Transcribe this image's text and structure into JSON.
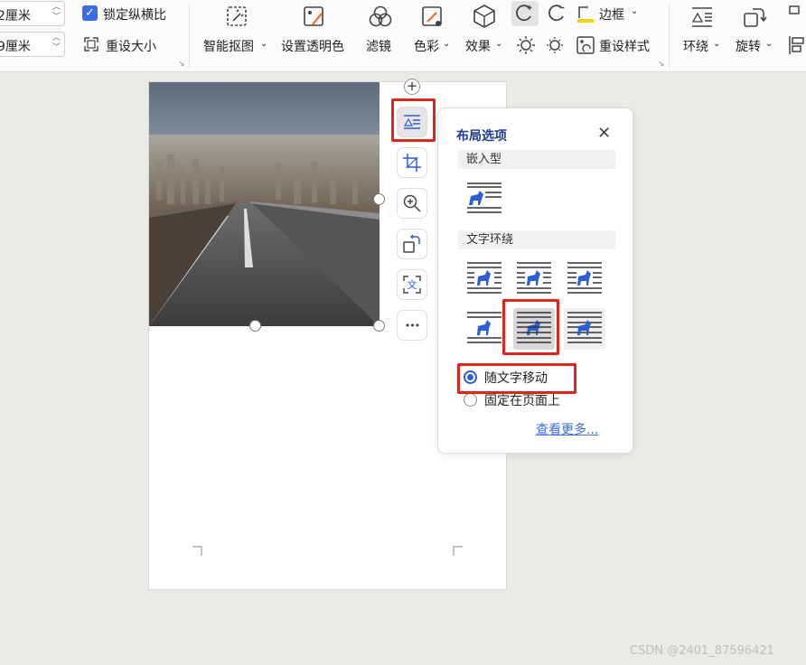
{
  "ribbon": {
    "height_value": "2厘米",
    "width_value": "9厘米",
    "lock_ratio_label": "锁定纵横比",
    "lock_ratio_checked": true,
    "reset_size_label": "重设大小",
    "smart_cutout_label": "智能抠图",
    "set_transparent_label": "设置透明色",
    "filter_label": "滤镜",
    "color_label": "色彩",
    "effect_label": "效果",
    "border_label": "边框",
    "reset_style_label": "重设样式",
    "wrap_label": "环绕",
    "rotate_label": "旋转"
  },
  "floating_toolbar": {
    "plus_label": "+",
    "more_label": "•••"
  },
  "layout_panel": {
    "title": "布局选项",
    "inline_section": "嵌入型",
    "wrap_section": "文字环绕",
    "move_with_text_label": "随文字移动",
    "fix_on_page_label": "固定在页面上",
    "selected_position_option": "随文字移动",
    "see_more_label": "查看更多..."
  },
  "colors": {
    "accent_blue": "#2c5fd6",
    "highlight_red": "#e2231a",
    "title_blue": "#1f3a93"
  },
  "watermark": "CSDN @2401_87596421"
}
